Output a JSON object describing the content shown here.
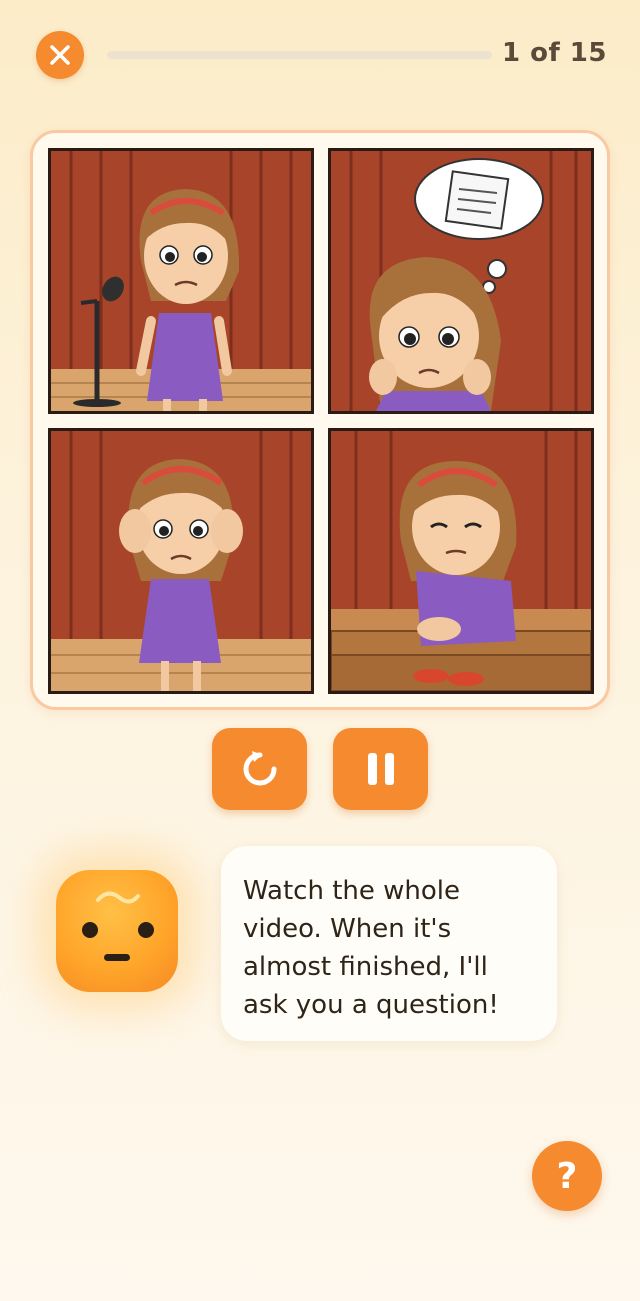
{
  "header": {
    "counter_text": "1 of 15",
    "progress_fraction": 0.0
  },
  "story": {
    "panels": [
      {
        "name": "panel-girl-at-microphone",
        "icon": "stage-scene"
      },
      {
        "name": "panel-girl-thinking-of-paper",
        "icon": "thought-bubble"
      },
      {
        "name": "panel-girl-covering-ears",
        "icon": "stage-scene"
      },
      {
        "name": "panel-girl-sitting-sad",
        "icon": "stage-scene"
      }
    ]
  },
  "controls": {
    "replay_icon": "replay-icon",
    "pause_icon": "pause-icon"
  },
  "mascot": {
    "icon": "worried-face-icon"
  },
  "message": {
    "text": "Watch the whole video. When it's almost finished, I'll ask you a question!"
  },
  "help": {
    "label": "?"
  },
  "colors": {
    "accent": "#f58a2e",
    "background": "#fdf3de",
    "frame_border": "#f9c9a2",
    "curtain": "#a8442a",
    "dress": "#8a5cc2"
  }
}
